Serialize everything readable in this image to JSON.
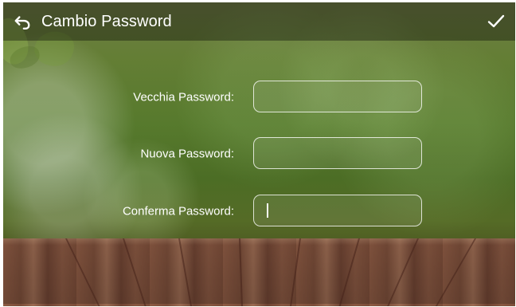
{
  "header": {
    "title": "Cambio Password",
    "back_icon": "back-arrow-icon",
    "confirm_icon": "checkmark-icon"
  },
  "form": {
    "old_password": {
      "label": "Vecchia Password:",
      "value": "",
      "placeholder": ""
    },
    "new_password": {
      "label": "Nuova Password:",
      "value": "",
      "placeholder": ""
    },
    "confirm_password": {
      "label": "Conferma Password:",
      "value": "",
      "placeholder": ""
    }
  },
  "colors": {
    "text": "#ffffff",
    "field_border": "#ffffff",
    "header_overlay": "#000000"
  }
}
